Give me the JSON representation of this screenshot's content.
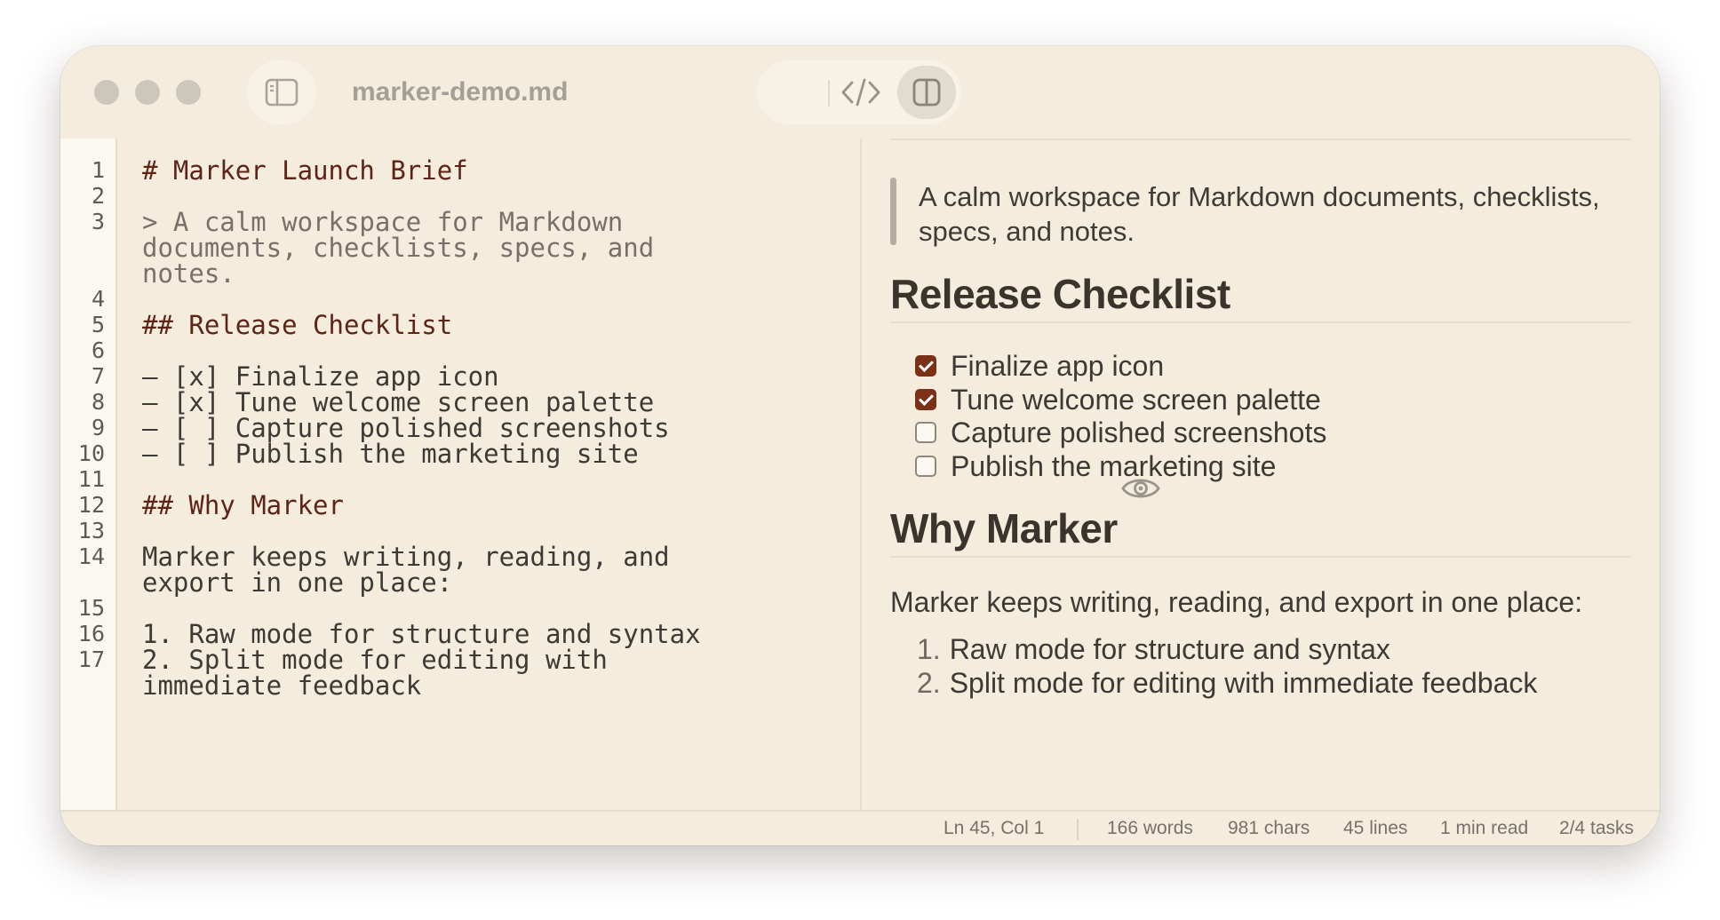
{
  "window": {
    "title": "marker-demo.md"
  },
  "toolbar": {
    "sidebar_icon": "sidebar-icon",
    "modes": [
      {
        "name": "preview",
        "icon": "eye-icon",
        "active": false
      },
      {
        "name": "raw",
        "icon": "code-icon",
        "active": false
      },
      {
        "name": "split",
        "icon": "split-view-icon",
        "active": true
      }
    ]
  },
  "editor": {
    "lines": [
      {
        "n": "1",
        "text": "# Marker Launch Brief",
        "kind": "heading"
      },
      {
        "n": "2",
        "text": "",
        "kind": "plain"
      },
      {
        "n": "3",
        "text": "> A calm workspace for Markdown",
        "kind": "quote"
      },
      {
        "n": "",
        "text": "documents, checklists, specs, and",
        "kind": "quote"
      },
      {
        "n": "",
        "text": "notes.",
        "kind": "quote"
      },
      {
        "n": "4",
        "text": "",
        "kind": "plain"
      },
      {
        "n": "5",
        "text": "## Release Checklist",
        "kind": "heading"
      },
      {
        "n": "6",
        "text": "",
        "kind": "plain"
      },
      {
        "n": "7",
        "text": "– [x] Finalize app icon",
        "kind": "plain"
      },
      {
        "n": "8",
        "text": "– [x] Tune welcome screen palette",
        "kind": "plain"
      },
      {
        "n": "9",
        "text": "– [ ] Capture polished screenshots",
        "kind": "plain"
      },
      {
        "n": "10",
        "text": "– [ ] Publish the marketing site",
        "kind": "plain"
      },
      {
        "n": "11",
        "text": "",
        "kind": "plain"
      },
      {
        "n": "12",
        "text": "## Why Marker",
        "kind": "heading"
      },
      {
        "n": "13",
        "text": "",
        "kind": "plain"
      },
      {
        "n": "14",
        "text": "Marker keeps writing, reading, and",
        "kind": "plain"
      },
      {
        "n": "",
        "text": "export in one place:",
        "kind": "plain"
      },
      {
        "n": "15",
        "text": "",
        "kind": "plain"
      },
      {
        "n": "16",
        "text": "1. Raw mode for structure and syntax",
        "kind": "plain"
      },
      {
        "n": "17",
        "text": "2. Split mode for editing with",
        "kind": "plain"
      },
      {
        "n": "",
        "text": "immediate feedback",
        "kind": "plain"
      }
    ]
  },
  "preview": {
    "blockquote": "A calm workspace for Markdown documents, checklists, specs, and notes.",
    "release_heading": "Release Checklist",
    "tasks": [
      {
        "label": "Finalize app icon",
        "checked": true
      },
      {
        "label": "Tune welcome screen palette",
        "checked": true
      },
      {
        "label": "Capture polished screenshots",
        "checked": false
      },
      {
        "label": "Publish the marketing site",
        "checked": false
      }
    ],
    "why_heading": "Why Marker",
    "paragraph": "Marker keeps writing, reading, and export in one place:",
    "ordered": [
      {
        "num": "1.",
        "text": "Raw mode for structure and syntax"
      },
      {
        "num": "2.",
        "text": "Split mode for editing with immediate feedback"
      }
    ]
  },
  "status": {
    "position": "Ln 45, Col 1",
    "words": "166 words",
    "chars": "981 chars",
    "lines": "45 lines",
    "read": "1 min read",
    "tasks": "2/4 tasks"
  },
  "colors": {
    "background": "#f4ecdc",
    "heading_source": "#5e2418",
    "checkbox_accent": "#7a3116"
  }
}
